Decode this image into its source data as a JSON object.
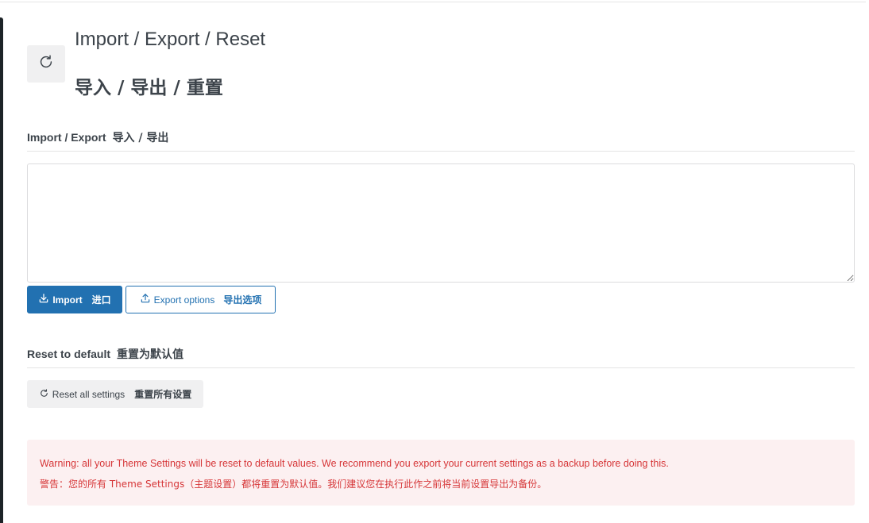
{
  "header": {
    "icon": "refresh-icon",
    "title_en": "Import / Export / Reset",
    "title_zh": "导入 / 导出 / 重置"
  },
  "import_export": {
    "heading_en": "Import / Export",
    "heading_zh": "导入 / 导出",
    "textarea_value": "",
    "import_button": {
      "icon": "download-icon",
      "label_en": "Import",
      "label_zh": "进口"
    },
    "export_button": {
      "icon": "upload-icon",
      "label_en": "Export options",
      "label_zh": "导出选项"
    }
  },
  "reset": {
    "heading_en": "Reset to default",
    "heading_zh": "重置为默认值",
    "reset_button": {
      "icon": "refresh-icon",
      "label_en": "Reset all settings",
      "label_zh": "重置所有设置"
    }
  },
  "notice": {
    "warning_en": "Warning: all your Theme Settings will be reset to default values. We recommend you export your current settings as a backup before doing this.",
    "warning_zh": "警告：您的所有 Theme Settings（主题设置）都将重置为默认值。我们建议您在执行此作之前将当前设置导出为备份。"
  },
  "colors": {
    "primary": "#2271b1",
    "warning_text": "#d63638",
    "warning_bg": "#fcf0f1",
    "text": "#3c434a"
  }
}
